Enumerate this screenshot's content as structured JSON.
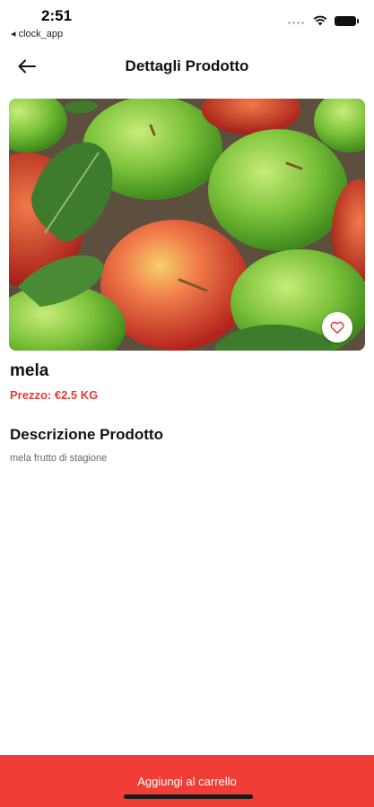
{
  "status_bar": {
    "time": "2:51",
    "back_app": "◂ clock_app"
  },
  "header": {
    "back_icon": "arrow-left-icon",
    "title": "Dettagli Prodotto"
  },
  "product": {
    "image_subject": "apples-photo",
    "favorite_icon": "heart-outline-icon",
    "name": "mela",
    "price": "Prezzo: €2.5 KG",
    "description_title": "Descrizione Prodotto",
    "description": "mela frutto di stagione"
  },
  "footer": {
    "add_to_cart_label": "Aggiungi al carrello"
  },
  "colors": {
    "accent_red": "#f03d36",
    "price_red": "#e53935"
  }
}
